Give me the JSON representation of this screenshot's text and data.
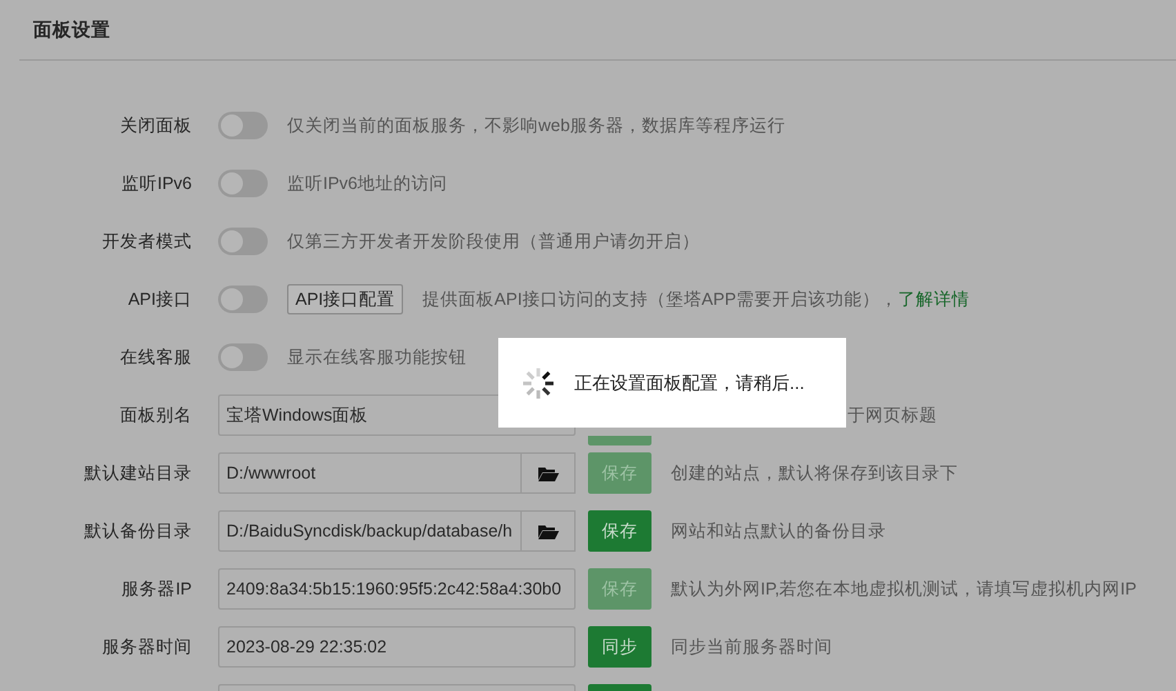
{
  "title": "面板设置",
  "rows": [
    {
      "kind": "toggle",
      "label": "关闭面板",
      "on": false,
      "description": "仅关闭当前的面板服务，不影响web服务器，数据库等程序运行"
    },
    {
      "kind": "toggle",
      "label": "监听IPv6",
      "on": false,
      "description": "监听IPv6地址的访问"
    },
    {
      "kind": "toggle",
      "label": "开发者模式",
      "on": false,
      "description": "仅第三方开发者开发阶段使用（普通用户请勿开启）"
    },
    {
      "kind": "toggle",
      "label": "API接口",
      "on": false,
      "button": "API接口配置",
      "description": "提供面板API接口访问的支持（堡塔APP需要开启该功能），",
      "link": "了解详情"
    },
    {
      "kind": "toggle",
      "label": "在线客服",
      "on": false,
      "description": "显示在线客服功能按钮"
    },
    {
      "kind": "input",
      "label": "面板别名",
      "value": "宝塔Windows面板",
      "description": "于网页标题",
      "description_covered": true
    },
    {
      "kind": "path",
      "label": "默认建站目录",
      "value": "D:/wwwroot",
      "action": {
        "label": "保存",
        "disabled": true
      },
      "description": "创建的站点，默认将保存到该目录下"
    },
    {
      "kind": "path",
      "label": "默认备份目录",
      "value": "D:/BaiduSyncdisk/backup/database/h",
      "action": {
        "label": "保存",
        "disabled": false
      },
      "description": "网站和站点默认的备份目录"
    },
    {
      "kind": "input",
      "label": "服务器IP",
      "value": "2409:8a34:5b15:1960:95f5:2c42:58a4:30b0",
      "action": {
        "label": "保存",
        "disabled": true
      },
      "description": "默认为外网IP,若您在本地虚拟机测试，请填写虚拟机内网IP"
    },
    {
      "kind": "input",
      "label": "服务器时间",
      "value": "2023-08-29 22:35:02",
      "action": {
        "label": "同步",
        "disabled": false
      },
      "description": "同步当前服务器时间"
    },
    {
      "kind": "input"
    }
  ],
  "toast": {
    "message": "正在设置面板配置，请稍后..."
  }
}
